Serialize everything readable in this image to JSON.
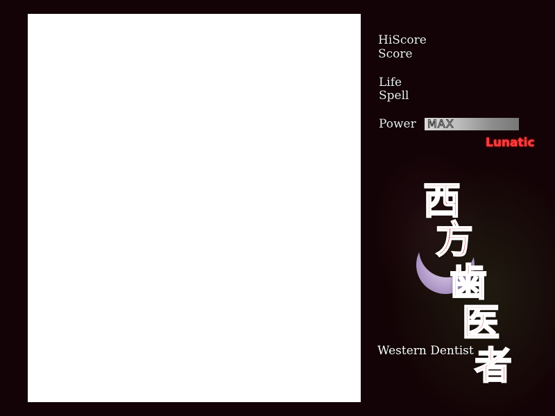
{
  "hud": {
    "hiscore_label": "HiScore",
    "score_label": "Score",
    "life_label": "Life",
    "spell_label": "Spell",
    "power_label": "Power",
    "power_value": "MAX",
    "difficulty": "Lunatic"
  },
  "logo": {
    "kanji": [
      "西",
      "方",
      "歯",
      "医",
      "者"
    ],
    "subtitle": "Western Dentist"
  },
  "colors": {
    "background": "#140306",
    "play_area": "#ffffff",
    "difficulty": "#ff3a3a",
    "kanji": "#b2101c"
  }
}
